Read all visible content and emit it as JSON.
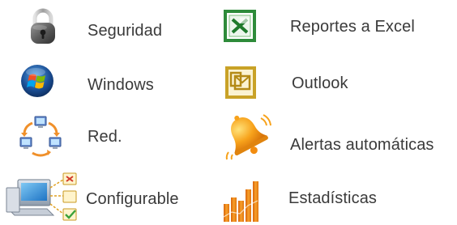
{
  "features": {
    "seguridad": {
      "label": "Seguridad",
      "icon": "padlock-icon"
    },
    "windows": {
      "label": "Windows",
      "icon": "windows-logo-icon"
    },
    "red": {
      "label": "Red.",
      "icon": "network-icon"
    },
    "configurable": {
      "label": "Configurable",
      "icon": "computer-settings-icon"
    },
    "excel": {
      "label": "Reportes a Excel",
      "icon": "excel-icon"
    },
    "outlook": {
      "label": "Outlook",
      "icon": "outlook-icon"
    },
    "alertas": {
      "label": "Alertas automáticas",
      "icon": "bell-icon"
    },
    "estadisticas": {
      "label": "Estadísticas",
      "icon": "bar-chart-icon"
    }
  },
  "colors": {
    "text": "#3a3a3a",
    "excel_green": "#2e8b3a",
    "outlook_gold": "#c9a227",
    "bell_orange": "#f7a21b",
    "chart_orange": "#f08a12"
  }
}
